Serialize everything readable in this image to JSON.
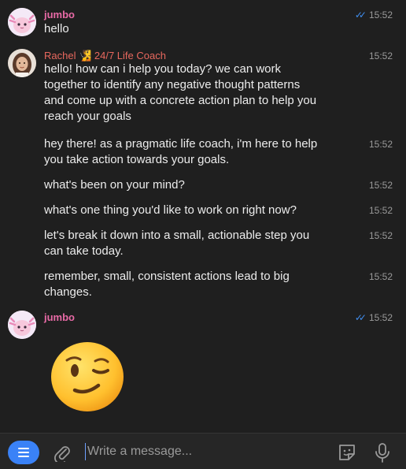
{
  "messages": {
    "m1": {
      "sender": "jumbo",
      "text": "hello",
      "time": "15:52"
    },
    "m2": {
      "sender": "Rachel 🧏 24/7 Life Coach",
      "time": "15:52",
      "line1": "hello! how can i help you today? we can work",
      "line2": "together to identify any negative thought patterns",
      "line3": "and come up with a concrete action plan to help you",
      "line4": "reach your goals"
    },
    "m3": {
      "time": "15:52",
      "line1": "hey there! as a pragmatic life coach, i'm here to help",
      "line2": "you take action towards your goals."
    },
    "m4": {
      "time": "15:52",
      "text": "what's been on your mind?"
    },
    "m5": {
      "time": "15:52",
      "text": "what's one thing you'd like to work on right now?"
    },
    "m6": {
      "time": "15:52",
      "line1": "let's break it down into a small, actionable step you",
      "line2": "can take today."
    },
    "m7": {
      "time": "15:52",
      "line1": "remember, small, consistent actions lead to big",
      "line2": "changes."
    },
    "m8": {
      "sender": "jumbo",
      "time": "15:52",
      "sticker": "winking-face-emoji"
    }
  },
  "composer": {
    "placeholder": "Write a message...",
    "menu_icon": "menu-icon",
    "attach_icon": "paperclip-icon",
    "sticker_icon": "sticker-icon",
    "mic_icon": "microphone-icon"
  },
  "colors": {
    "accent": "#3a82f7",
    "jumbo_name": "#e86aa6",
    "rachel_name": "#e8685e",
    "background": "#1f1f1f"
  }
}
